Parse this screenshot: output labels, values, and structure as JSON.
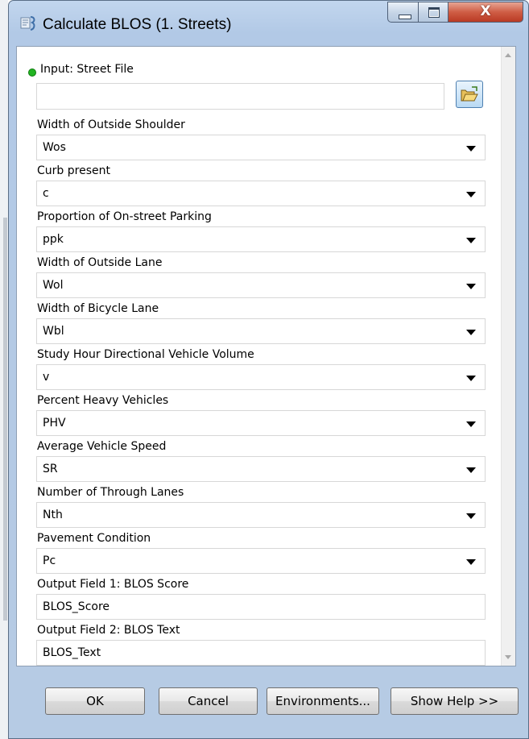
{
  "window": {
    "title": "Calculate BLOS (1. Streets)",
    "close_glyph": "X",
    "colors": {
      "titlebar": "#b9cfea",
      "close": "#c9533c",
      "required_dot": "#22b522"
    }
  },
  "input": {
    "label": "Input: Street File",
    "value": ""
  },
  "parameters": [
    {
      "label": "Width of Outside Shoulder",
      "value": "Wos"
    },
    {
      "label": "Curb present",
      "value": "c"
    },
    {
      "label": "Proportion of On-street Parking",
      "value": "ppk"
    },
    {
      "label": "Width of Outside Lane",
      "value": "Wol"
    },
    {
      "label": "Width of Bicycle Lane",
      "value": "Wbl"
    },
    {
      "label": "Study Hour Directional Vehicle Volume",
      "value": "v"
    },
    {
      "label": "Percent Heavy Vehicles",
      "value": "PHV"
    },
    {
      "label": "Average Vehicle Speed",
      "value": "SR"
    },
    {
      "label": "Number of Through Lanes",
      "value": "Nth"
    },
    {
      "label": "Pavement Condition",
      "value": "Pc"
    }
  ],
  "outputs": [
    {
      "label": "Output Field 1: BLOS Score",
      "value": "BLOS_Score"
    },
    {
      "label": "Output Field 2: BLOS Text",
      "value": "BLOS_Text"
    }
  ],
  "buttons": {
    "ok": "OK",
    "cancel": "Cancel",
    "environments": "Environments...",
    "help": "Show Help >>"
  }
}
